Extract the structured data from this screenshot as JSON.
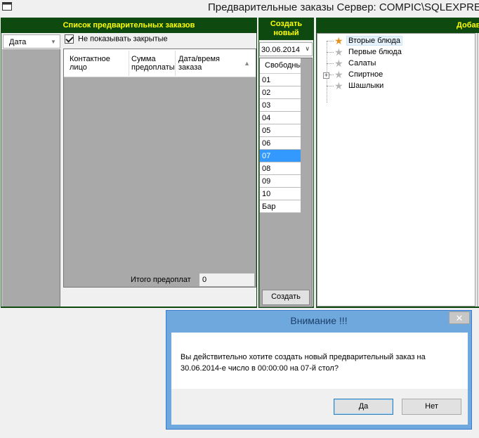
{
  "window": {
    "title": "Предварительные заказы  Сервер: COMPIC\\SQLEXPRESS",
    "icon": "app-window-icon"
  },
  "orders_panel": {
    "header": "Список предварительных заказов",
    "date_filter": "Дата",
    "hide_closed_label": "Не показывать закрытые",
    "hide_closed_checked": true,
    "columns": {
      "contact": "Контактное лицо",
      "sum": "Сумма предоплаты",
      "datetime": "Дата/время заказа"
    },
    "total_label": "Итого предоплат",
    "total_value": "0"
  },
  "create_panel": {
    "header": "Создать новый",
    "date": "30.06.2014",
    "tables_header": "Свободные",
    "tables": [
      "01",
      "02",
      "03",
      "04",
      "05",
      "06",
      "07",
      "08",
      "09",
      "10",
      "Бар"
    ],
    "selected_table": "07",
    "create_button": "Создать"
  },
  "add_panel": {
    "header": "Добавить",
    "tree": [
      "Вторые блюда",
      "Первые блюда",
      "Салаты",
      "Спиртное",
      "Шашлыки"
    ],
    "selected_item": "Вторые блюда"
  },
  "dialog": {
    "title": "Внимание !!!",
    "message_line1": "Вы действительно хотите создать новый предварительный заказ на",
    "message_line2": "30.06.2014-е число в 00:00:00 на 07-й стол?",
    "yes": "Да",
    "no": "Нет",
    "close": "✕"
  },
  "colors": {
    "panel_header_bg": "#0e4a10",
    "panel_header_text": "#ffff00",
    "selection": "#3399ff"
  }
}
